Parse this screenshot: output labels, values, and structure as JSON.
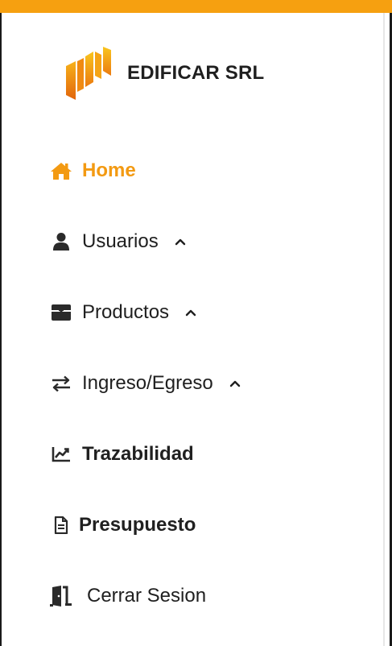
{
  "brand": {
    "name": "EDIFICAR SRL",
    "logo_icon": "building-bars-logo"
  },
  "colors": {
    "accent": "#F39A12",
    "top_bar": "#F6A010",
    "text": "#202020"
  },
  "nav": {
    "items": [
      {
        "label": "Home",
        "icon": "home-icon",
        "active": true
      },
      {
        "label": "Usuarios",
        "icon": "user-icon",
        "expandable": true
      },
      {
        "label": "Productos",
        "icon": "box-icon",
        "expandable": true
      },
      {
        "label": "Ingreso/Egreso",
        "icon": "exchange-icon",
        "expandable": true
      },
      {
        "label": "Trazabilidad",
        "icon": "chart-line-icon"
      },
      {
        "label": "Presupuesto",
        "icon": "document-icon"
      },
      {
        "label": "Cerrar Sesion",
        "icon": "door-exit-icon"
      }
    ]
  }
}
